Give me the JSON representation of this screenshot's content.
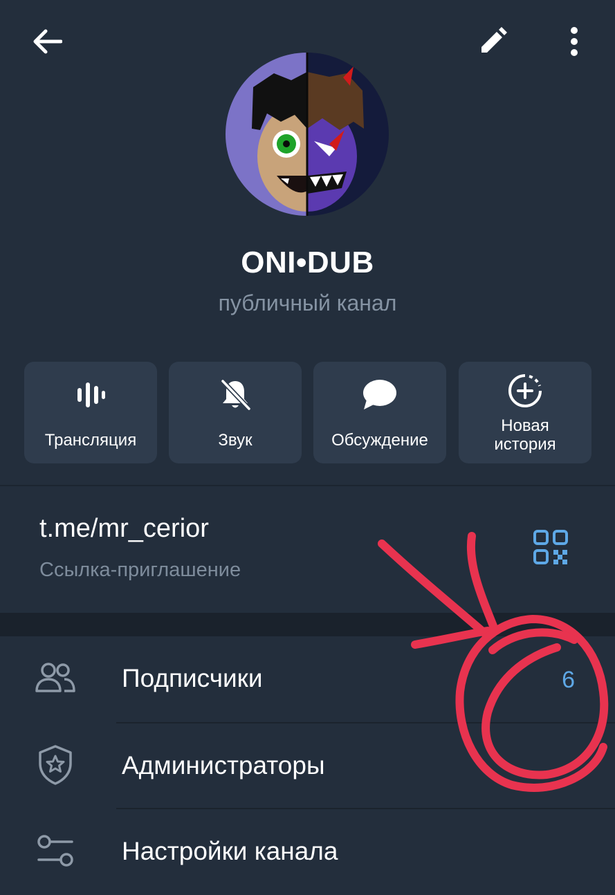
{
  "header": {
    "back_icon": "arrow-left-icon",
    "edit_icon": "pencil-icon",
    "more_icon": "more-vertical-icon"
  },
  "channel": {
    "name": "ONI•DUB",
    "type": "публичный канал"
  },
  "actions": [
    {
      "label": "Трансляция",
      "icon": "live-stream-icon"
    },
    {
      "label": "Звук",
      "icon": "bell-off-icon"
    },
    {
      "label": "Обсуждение",
      "icon": "chat-bubble-icon"
    },
    {
      "label_line1": "Новая",
      "label_line2": "история",
      "icon": "new-story-icon"
    }
  ],
  "invite": {
    "link": "t.me/mr_cerior",
    "caption": "Ссылка-приглашение",
    "qr_icon": "qr-code-icon"
  },
  "menu": [
    {
      "label": "Подписчики",
      "value": "6",
      "icon": "users-icon"
    },
    {
      "label": "Администраторы",
      "icon": "shield-star-icon"
    },
    {
      "label": "Настройки канала",
      "icon": "settings-sliders-icon"
    }
  ],
  "colors": {
    "background": "#232e3c",
    "card": "#2f3c4d",
    "accent": "#5ea8e6",
    "annotation": "#e8334f"
  }
}
